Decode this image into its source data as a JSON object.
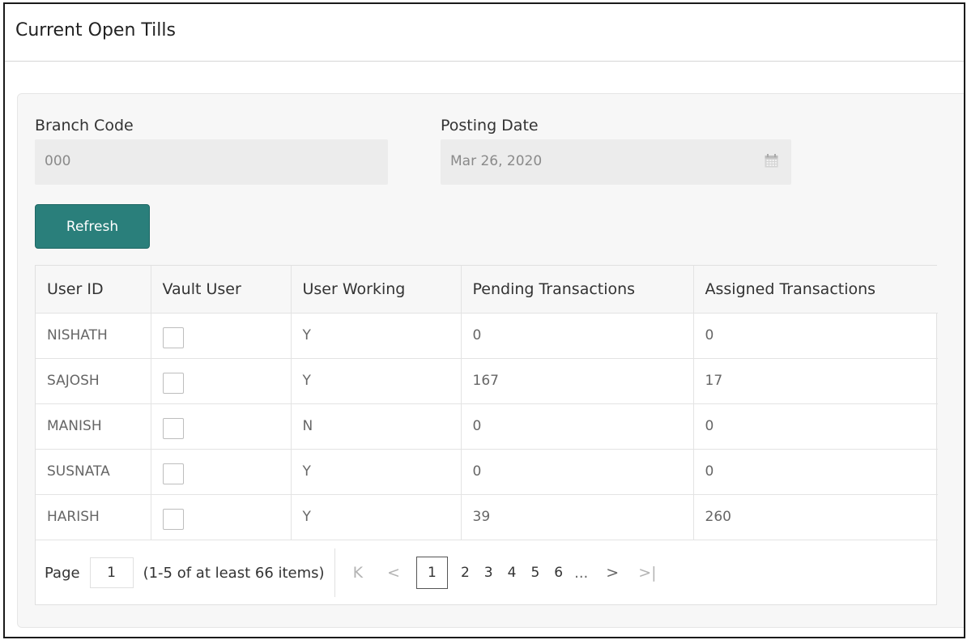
{
  "page": {
    "title": "Current Open Tills"
  },
  "form": {
    "branch_code_label": "Branch Code",
    "branch_code_value": "000",
    "posting_date_label": "Posting Date",
    "posting_date_value": "Mar 26, 2020",
    "calendar_icon": "calendar-icon"
  },
  "actions": {
    "refresh_label": "Refresh"
  },
  "table": {
    "columns": [
      "User ID",
      "Vault User",
      "User Working",
      "Pending Transactions",
      "Assigned Transactions"
    ],
    "rows": [
      {
        "user_id": "NISHATH",
        "vault_user": false,
        "user_working": "Y",
        "pending": "0",
        "assigned": "0"
      },
      {
        "user_id": "SAJOSH",
        "vault_user": false,
        "user_working": "Y",
        "pending": "167",
        "assigned": "17"
      },
      {
        "user_id": "MANISH",
        "vault_user": false,
        "user_working": "N",
        "pending": "0",
        "assigned": "0"
      },
      {
        "user_id": "SUSNATA",
        "vault_user": false,
        "user_working": "Y",
        "pending": "0",
        "assigned": "0"
      },
      {
        "user_id": "HARISH",
        "vault_user": false,
        "user_working": "Y",
        "pending": "39",
        "assigned": "260"
      }
    ]
  },
  "pagination": {
    "page_label": "Page",
    "current_page": "1",
    "items_info": "(1-5 of at least 66 items)",
    "first_icon": "⟩|",
    "pages": [
      "1",
      "2",
      "3",
      "4",
      "5",
      "6"
    ],
    "ellipsis": "...",
    "glyphs": {
      "first": "K",
      "prev": "<",
      "next": ">",
      "last": ">|"
    }
  }
}
